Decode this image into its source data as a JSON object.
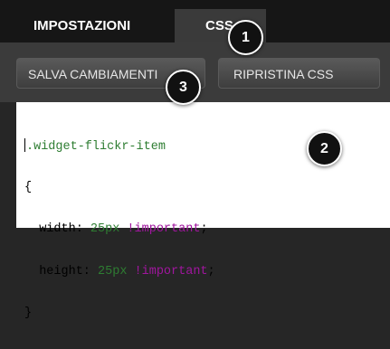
{
  "tabs": {
    "settings_label": "IMPOSTAZIONI",
    "css_label": "CSS"
  },
  "toolbar": {
    "save_label": "SALVA CAMBIAMENTI",
    "reset_label": "RIPRISTINA CSS"
  },
  "editor": {
    "selector": ".widget-flickr-item",
    "open_brace": "{",
    "width_prop": "  width: ",
    "width_value": "25px",
    "width_important": " !important",
    "width_semicolon": ";",
    "height_prop": "  height: ",
    "height_value": "25px",
    "height_important": " !important",
    "height_semicolon": ";",
    "close_brace": "}"
  },
  "annotations": {
    "one": "1",
    "two": "2",
    "three": "3"
  },
  "colors": {
    "selector": "#2e7d32",
    "important": "#a0169e",
    "badge": "#111111"
  }
}
